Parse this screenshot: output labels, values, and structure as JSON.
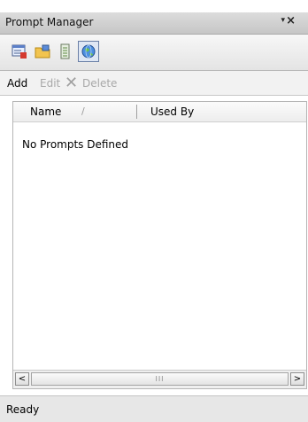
{
  "window": {
    "title": "Prompt Manager",
    "pin_glyph": "▾",
    "close_glyph": "×"
  },
  "toolbar": {
    "buttons": [
      {
        "icon": "prompt-list-icon"
      },
      {
        "icon": "folder-icon"
      },
      {
        "icon": "document-icon"
      },
      {
        "icon": "globe-icon",
        "active": true
      }
    ]
  },
  "actions": {
    "add": "Add",
    "edit": "Edit",
    "delete_icon": "✕",
    "delete": "Delete"
  },
  "list": {
    "columns": [
      "Name",
      "Used By"
    ],
    "sort_indicator": "/",
    "empty_message": "No Prompts Defined"
  },
  "scrollbar": {
    "left": "<",
    "right": ">",
    "grip": "III"
  },
  "status": {
    "text": "Ready"
  },
  "colors": {
    "active_border": "#6a7fa6",
    "disabled_text": "#a8a8a8"
  }
}
